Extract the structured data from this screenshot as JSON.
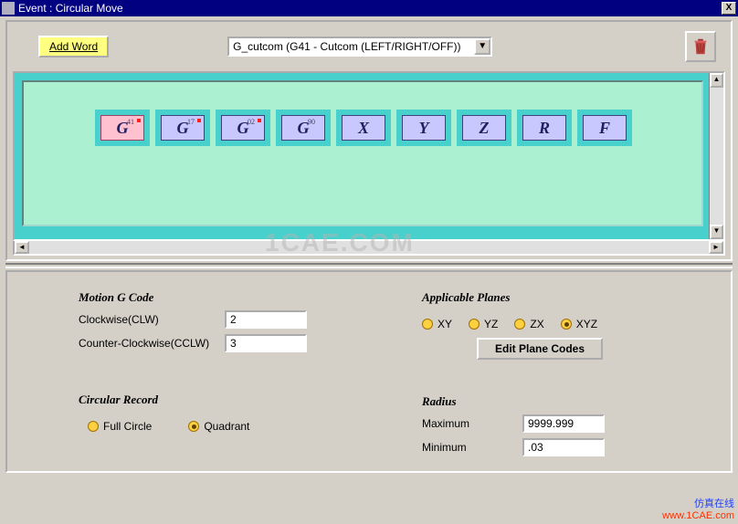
{
  "window": {
    "title": "Event : Circular Move",
    "close": "X"
  },
  "toolbar": {
    "add_word": "Add Word",
    "dropdown_value": "G_cutcom (G41 - Cutcom (LEFT/RIGHT/OFF))"
  },
  "tokens": [
    {
      "letter": "G",
      "sup": "41",
      "dot": true,
      "pink": true
    },
    {
      "letter": "G",
      "sup": "17",
      "dot": true,
      "pink": false
    },
    {
      "letter": "G",
      "sup": "02",
      "dot": true,
      "pink": false
    },
    {
      "letter": "G",
      "sup": "90",
      "dot": false,
      "pink": false
    },
    {
      "letter": "X",
      "sup": "",
      "dot": false,
      "pink": false
    },
    {
      "letter": "Y",
      "sup": "",
      "dot": false,
      "pink": false
    },
    {
      "letter": "Z",
      "sup": "",
      "dot": false,
      "pink": false
    },
    {
      "letter": "R",
      "sup": "",
      "dot": false,
      "pink": false
    },
    {
      "letter": "F",
      "sup": "",
      "dot": false,
      "pink": false
    }
  ],
  "watermark": "1CAE.COM",
  "motion": {
    "legend": "Motion G Code",
    "cw_label": "Clockwise(CLW)",
    "cw_value": "2",
    "ccw_label": "Counter-Clockwise(CCLW)",
    "ccw_value": "3"
  },
  "planes": {
    "legend": "Applicable Planes",
    "opts": [
      "XY",
      "YZ",
      "ZX",
      "XYZ"
    ],
    "selected": "XYZ",
    "edit": "Edit Plane Codes"
  },
  "circular": {
    "legend": "Circular Record",
    "opts": [
      "Full Circle",
      "Quadrant"
    ],
    "selected": "Quadrant"
  },
  "radius": {
    "legend": "Radius",
    "max_label": "Maximum",
    "max_value": "9999.999",
    "min_label": "Minimum",
    "min_value": ".03"
  },
  "corner": {
    "line1": "仿真在线",
    "line2": "www.1CAE.com"
  }
}
